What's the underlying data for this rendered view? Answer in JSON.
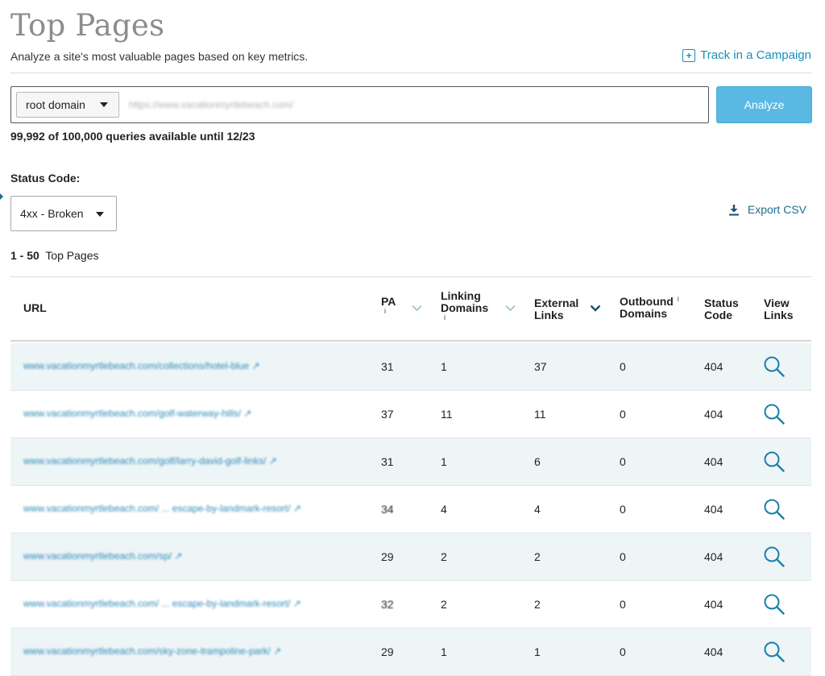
{
  "header": {
    "title": "Top Pages",
    "subtitle": "Analyze a site's most valuable pages based on key metrics.",
    "track_link": "Track in a Campaign"
  },
  "search": {
    "scope": "root domain",
    "url_value": "https://www.vacationmyrtlebeach.com/",
    "analyze_label": "Analyze",
    "quota_text": "99,992 of 100,000 queries available until 12/23"
  },
  "filters": {
    "status_label": "Status Code:",
    "status_value": "4xx - Broken",
    "export_label": "Export CSV"
  },
  "range": {
    "bold": "1 - 50",
    "rest": "Top Pages"
  },
  "table": {
    "headers": {
      "url": "URL",
      "pa": "PA",
      "ld1": "Linking",
      "ld2": "Domains",
      "el1": "External",
      "el2": "Links",
      "od1": "Outbound",
      "od2": "Domains",
      "sc1": "Status",
      "sc2": "Code",
      "vl1": "View",
      "vl2": "Links",
      "info": "i"
    },
    "rows": [
      {
        "url": "www.vacationmyrtlebeach.com/collections/hotel-blue ↗",
        "pa": "31",
        "ld": "1",
        "el": "37",
        "od": "0",
        "sc": "404"
      },
      {
        "url": "www.vacationmyrtlebeach.com/golf-waterway-hills/ ↗",
        "pa": "37",
        "ld": "11",
        "el": "11",
        "od": "0",
        "sc": "404"
      },
      {
        "url": "www.vacationmyrtlebeach.com/golf/larry-david-golf-links/ ↗",
        "pa": "31",
        "ld": "1",
        "el": "6",
        "od": "0",
        "sc": "404"
      },
      {
        "url": "www.vacationmyrtlebeach.com/ ... escape-by-landmark-resort/ ↗",
        "pa": "34",
        "ld": "4",
        "el": "4",
        "od": "0",
        "sc": "404"
      },
      {
        "url": "www.vacationmyrtlebeach.com/sp/ ↗",
        "pa": "29",
        "ld": "2",
        "el": "2",
        "od": "0",
        "sc": "404"
      },
      {
        "url": "www.vacationmyrtlebeach.com/ ... escape-by-landmark-resort/ ↗",
        "pa": "32",
        "ld": "2",
        "el": "2",
        "od": "0",
        "sc": "404"
      },
      {
        "url": "www.vacationmyrtlebeach.com/sky-zone-trampoline-park/ ↗",
        "pa": "29",
        "ld": "1",
        "el": "1",
        "od": "0",
        "sc": "404"
      }
    ]
  },
  "colors": {
    "accent": "#1a8fb8",
    "analyze_button": "#59b9e3",
    "row_alt": "#eef5f7"
  }
}
